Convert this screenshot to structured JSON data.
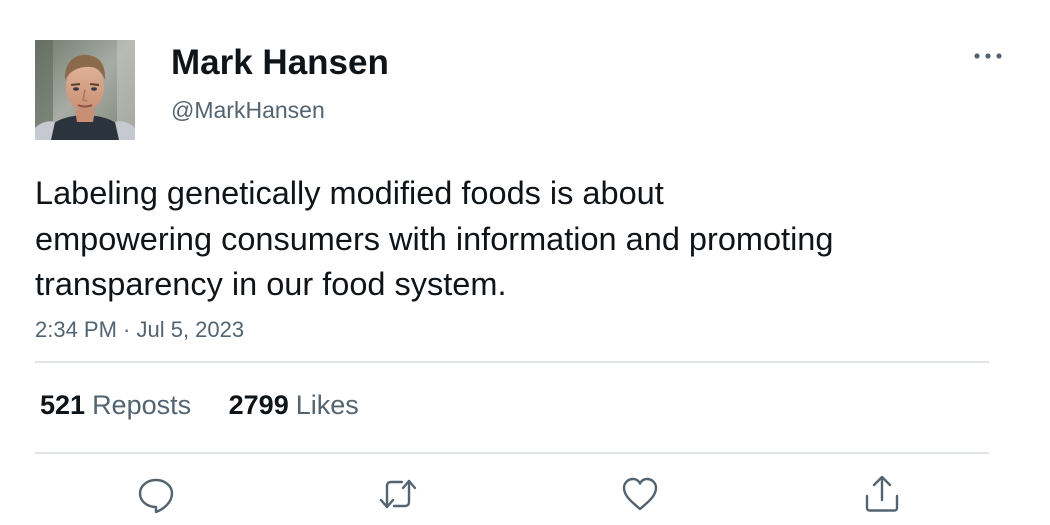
{
  "author": {
    "display_name": "Mark Hansen",
    "handle": "@MarkHansen"
  },
  "tweet": {
    "text_lines": [
      "Labeling genetically modified foods is about",
      "empowering consumers with information and promoting",
      "transparency in our food system."
    ],
    "timestamp": "2:34 PM · Jul 5, 2023"
  },
  "stats": {
    "reposts_count": "521",
    "reposts_label": "Reposts",
    "likes_count": "2799",
    "likes_label": "Likes"
  },
  "icons": {
    "more": "more-horizontal-icon",
    "reply": "reply-icon",
    "repost": "repost-icon",
    "like": "heart-icon",
    "share": "share-icon"
  },
  "colors": {
    "primary_text": "#0f1419",
    "secondary_text": "#536471",
    "divider": "#e1e4e6",
    "icon": "#536471"
  }
}
